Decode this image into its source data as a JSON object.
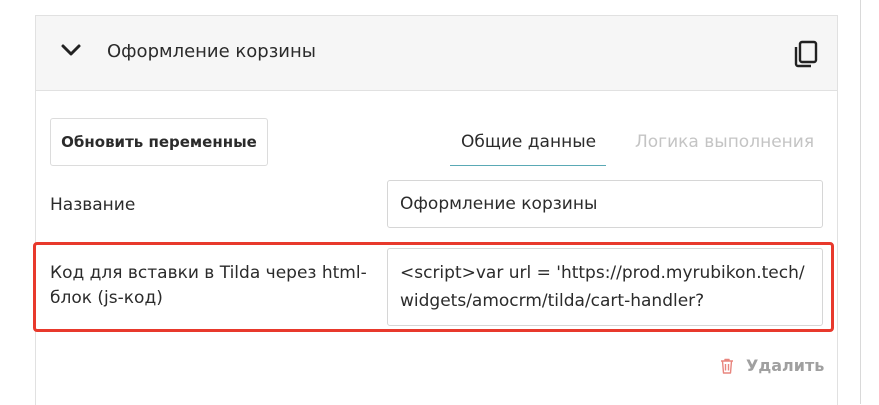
{
  "section": {
    "title": "Оформление корзины"
  },
  "toolbar": {
    "update_label": "Обновить переменные"
  },
  "tabs": [
    {
      "label": "Общие данные",
      "active": true
    },
    {
      "label": "Логика выполнения",
      "active": false
    }
  ],
  "form": {
    "name_label": "Название",
    "name_value": "Оформление корзины",
    "code_label": "Код для вставки в Tilda через html-блок (js-код)",
    "code_value": "<script>var url = 'https://prod.myrubikon.tech/widgets/amocrm/tilda/cart-handler?"
  },
  "actions": {
    "delete_label": "Удалить"
  },
  "colors": {
    "highlight": "#e8392c",
    "tab_underline": "#5aa9b5",
    "delete_icon": "#e8857e"
  },
  "icons": [
    "chevron-down-icon",
    "copy-icon",
    "trash-icon"
  ]
}
